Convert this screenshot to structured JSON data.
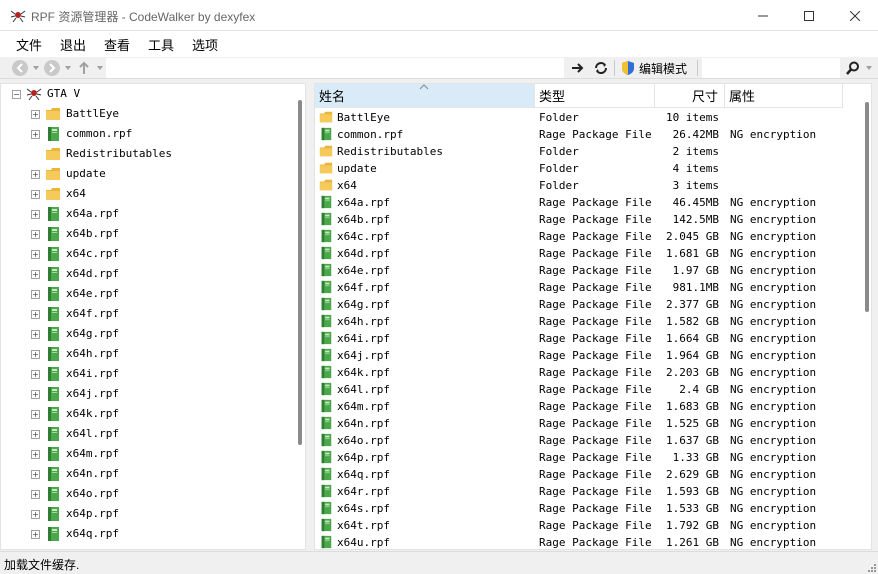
{
  "window": {
    "title": "RPF 资源管理器 - CodeWalker by dexyfex",
    "app_icon": "codewalker-spider-icon"
  },
  "menu": [
    "文件",
    "退出",
    "查看",
    "工具",
    "选项"
  ],
  "toolbar": {
    "path_value": "",
    "edit_mode_label": "编辑模式",
    "search_value": ""
  },
  "tree": {
    "root": "GTA V",
    "items": [
      {
        "label": "BattlEye",
        "type": "folder",
        "expandable": true
      },
      {
        "label": "common.rpf",
        "type": "rpf",
        "expandable": true
      },
      {
        "label": "Redistributables",
        "type": "folder",
        "expandable": false
      },
      {
        "label": "update",
        "type": "folder",
        "expandable": true
      },
      {
        "label": "x64",
        "type": "folder",
        "expandable": true
      },
      {
        "label": "x64a.rpf",
        "type": "rpf",
        "expandable": true
      },
      {
        "label": "x64b.rpf",
        "type": "rpf",
        "expandable": true
      },
      {
        "label": "x64c.rpf",
        "type": "rpf",
        "expandable": true
      },
      {
        "label": "x64d.rpf",
        "type": "rpf",
        "expandable": true
      },
      {
        "label": "x64e.rpf",
        "type": "rpf",
        "expandable": true
      },
      {
        "label": "x64f.rpf",
        "type": "rpf",
        "expandable": true
      },
      {
        "label": "x64g.rpf",
        "type": "rpf",
        "expandable": true
      },
      {
        "label": "x64h.rpf",
        "type": "rpf",
        "expandable": true
      },
      {
        "label": "x64i.rpf",
        "type": "rpf",
        "expandable": true
      },
      {
        "label": "x64j.rpf",
        "type": "rpf",
        "expandable": true
      },
      {
        "label": "x64k.rpf",
        "type": "rpf",
        "expandable": true
      },
      {
        "label": "x64l.rpf",
        "type": "rpf",
        "expandable": true
      },
      {
        "label": "x64m.rpf",
        "type": "rpf",
        "expandable": true
      },
      {
        "label": "x64n.rpf",
        "type": "rpf",
        "expandable": true
      },
      {
        "label": "x64o.rpf",
        "type": "rpf",
        "expandable": true
      },
      {
        "label": "x64p.rpf",
        "type": "rpf",
        "expandable": true
      },
      {
        "label": "x64q.rpf",
        "type": "rpf",
        "expandable": true
      }
    ]
  },
  "list": {
    "columns": [
      "姓名",
      "类型",
      "尺寸",
      "属性"
    ],
    "rows": [
      {
        "name": "BattlEye",
        "type": "Folder",
        "size": "10 items",
        "attr": "",
        "icon": "folder"
      },
      {
        "name": "common.rpf",
        "type": "Rage Package File",
        "size": "26.42MB",
        "attr": "NG encryption",
        "icon": "rpf"
      },
      {
        "name": "Redistributables",
        "type": "Folder",
        "size": "2 items",
        "attr": "",
        "icon": "folder"
      },
      {
        "name": "update",
        "type": "Folder",
        "size": "4 items",
        "attr": "",
        "icon": "folder"
      },
      {
        "name": "x64",
        "type": "Folder",
        "size": "3 items",
        "attr": "",
        "icon": "folder"
      },
      {
        "name": "x64a.rpf",
        "type": "Rage Package File",
        "size": "46.45MB",
        "attr": "NG encryption",
        "icon": "rpf"
      },
      {
        "name": "x64b.rpf",
        "type": "Rage Package File",
        "size": "142.5MB",
        "attr": "NG encryption",
        "icon": "rpf"
      },
      {
        "name": "x64c.rpf",
        "type": "Rage Package File",
        "size": "2.045 GB",
        "attr": "NG encryption",
        "icon": "rpf"
      },
      {
        "name": "x64d.rpf",
        "type": "Rage Package File",
        "size": "1.681 GB",
        "attr": "NG encryption",
        "icon": "rpf"
      },
      {
        "name": "x64e.rpf",
        "type": "Rage Package File",
        "size": "1.97 GB",
        "attr": "NG encryption",
        "icon": "rpf"
      },
      {
        "name": "x64f.rpf",
        "type": "Rage Package File",
        "size": "981.1MB",
        "attr": "NG encryption",
        "icon": "rpf"
      },
      {
        "name": "x64g.rpf",
        "type": "Rage Package File",
        "size": "2.377 GB",
        "attr": "NG encryption",
        "icon": "rpf"
      },
      {
        "name": "x64h.rpf",
        "type": "Rage Package File",
        "size": "1.582 GB",
        "attr": "NG encryption",
        "icon": "rpf"
      },
      {
        "name": "x64i.rpf",
        "type": "Rage Package File",
        "size": "1.664 GB",
        "attr": "NG encryption",
        "icon": "rpf"
      },
      {
        "name": "x64j.rpf",
        "type": "Rage Package File",
        "size": "1.964 GB",
        "attr": "NG encryption",
        "icon": "rpf"
      },
      {
        "name": "x64k.rpf",
        "type": "Rage Package File",
        "size": "2.203 GB",
        "attr": "NG encryption",
        "icon": "rpf"
      },
      {
        "name": "x64l.rpf",
        "type": "Rage Package File",
        "size": "2.4 GB",
        "attr": "NG encryption",
        "icon": "rpf"
      },
      {
        "name": "x64m.rpf",
        "type": "Rage Package File",
        "size": "1.683 GB",
        "attr": "NG encryption",
        "icon": "rpf"
      },
      {
        "name": "x64n.rpf",
        "type": "Rage Package File",
        "size": "1.525 GB",
        "attr": "NG encryption",
        "icon": "rpf"
      },
      {
        "name": "x64o.rpf",
        "type": "Rage Package File",
        "size": "1.637 GB",
        "attr": "NG encryption",
        "icon": "rpf"
      },
      {
        "name": "x64p.rpf",
        "type": "Rage Package File",
        "size": "1.33 GB",
        "attr": "NG encryption",
        "icon": "rpf"
      },
      {
        "name": "x64q.rpf",
        "type": "Rage Package File",
        "size": "2.629 GB",
        "attr": "NG encryption",
        "icon": "rpf"
      },
      {
        "name": "x64r.rpf",
        "type": "Rage Package File",
        "size": "1.593 GB",
        "attr": "NG encryption",
        "icon": "rpf"
      },
      {
        "name": "x64s.rpf",
        "type": "Rage Package File",
        "size": "1.533 GB",
        "attr": "NG encryption",
        "icon": "rpf"
      },
      {
        "name": "x64t.rpf",
        "type": "Rage Package File",
        "size": "1.792 GB",
        "attr": "NG encryption",
        "icon": "rpf"
      },
      {
        "name": "x64u.rpf",
        "type": "Rage Package File",
        "size": "1.261 GB",
        "attr": "NG encryption",
        "icon": "rpf"
      }
    ]
  },
  "status": {
    "text": "加载文件缓存."
  },
  "colors": {
    "folder": "#f5c95a",
    "rpf": "#4aa84a",
    "sorted_header": "#d9ebf9",
    "edit_shield_blue": "#2f6fd6",
    "edit_shield_yellow": "#f2c12e"
  }
}
